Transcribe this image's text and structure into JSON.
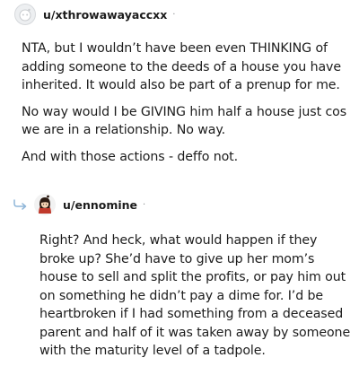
{
  "comments": [
    {
      "username": "u/xthrowawayaccxx",
      "separator": "·",
      "avatar_icon": "default-avatar-icon",
      "paragraphs": [
        "NTA, but I wouldn’t have been even THINKING of adding someone to the deeds of a house you have inherited. It would also be part of a prenup for me.",
        "No way would I be GIVING him half a house just cos we are in a relationship. No way.",
        "And with those actions - deffo not."
      ]
    },
    {
      "username": "u/ennomine",
      "separator": "·",
      "avatar_icon": "user-avatar-icon",
      "reply_icon": "reply-arrow-icon",
      "paragraphs": [
        "Right? And heck, what would happen if they broke up? She’d have to give up her mom’s house to sell and split the profits, or pay him out on something he didn’t pay a dime for. I’d be heartbroken if I had something from a deceased parent and half of it was taken away by someone with the maturity level of a tadpole."
      ]
    }
  ]
}
